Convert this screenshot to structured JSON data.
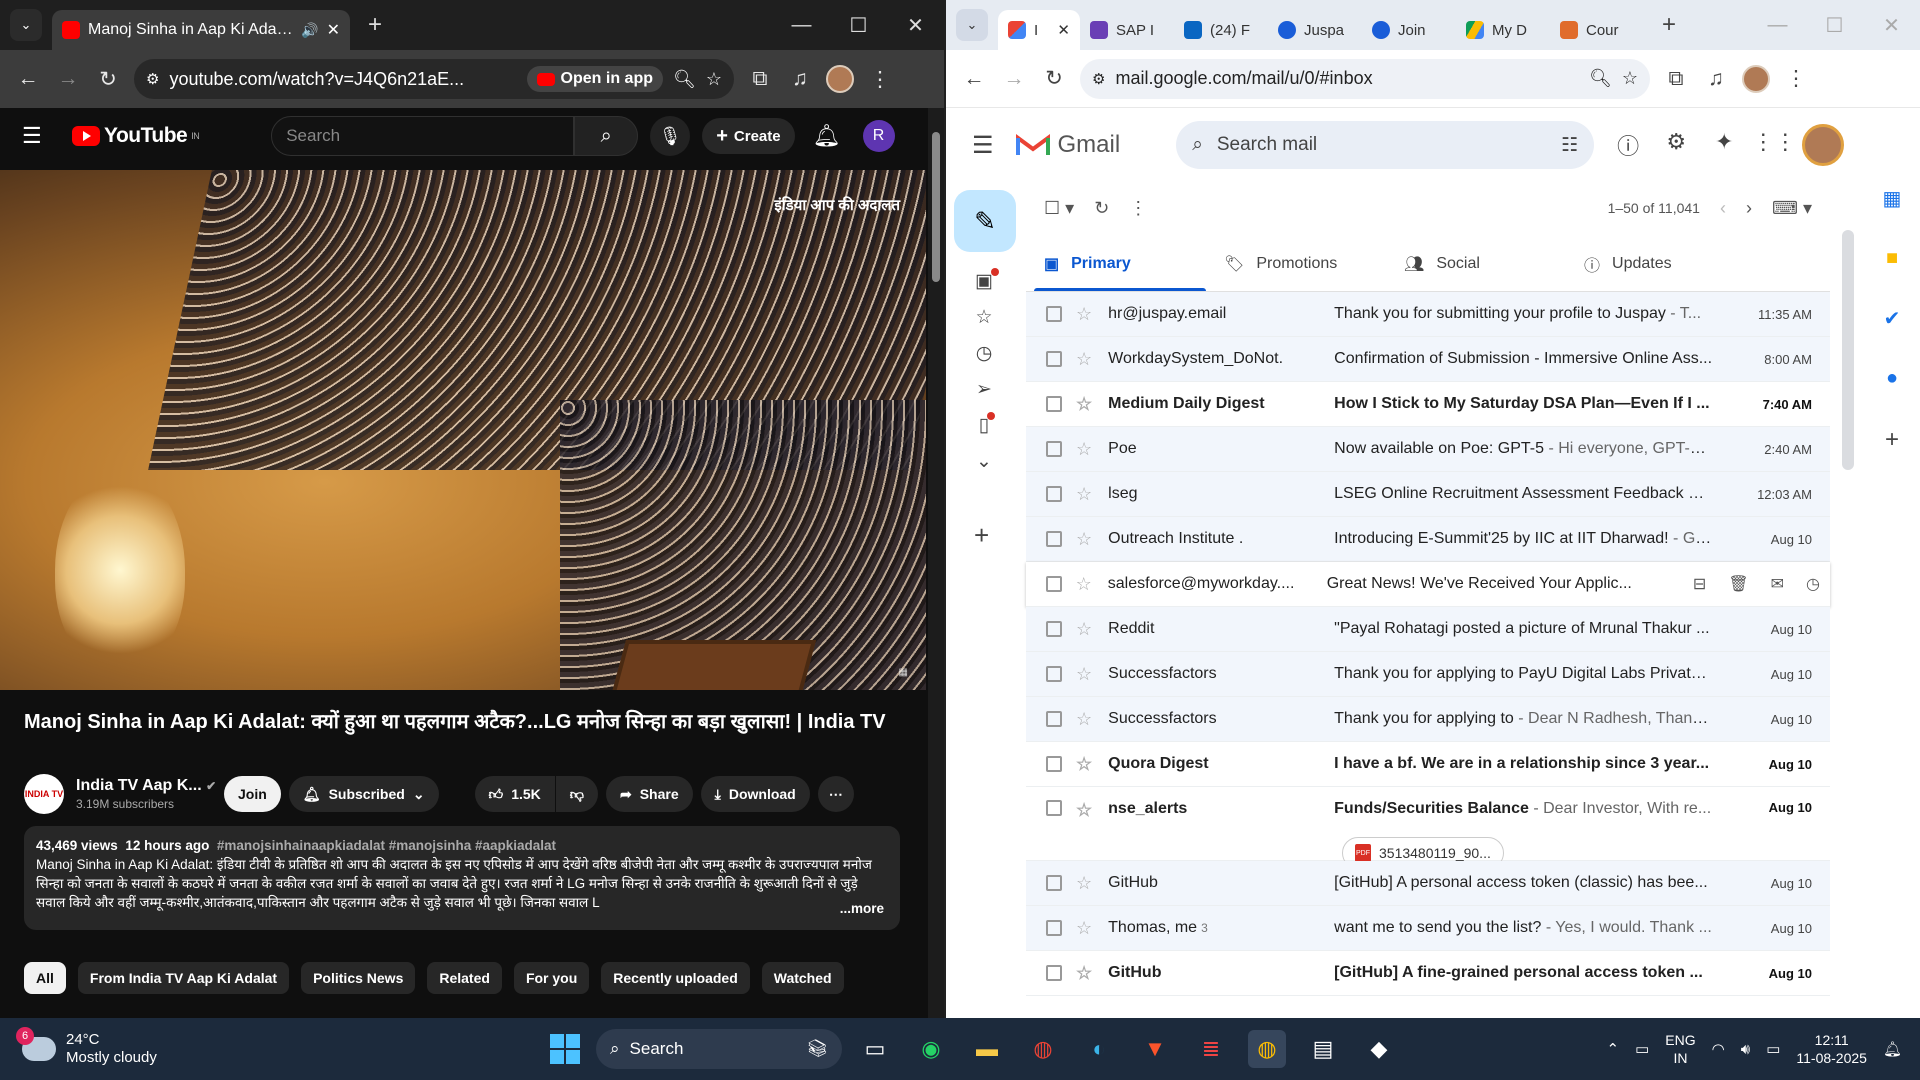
{
  "left_browser": {
    "tab_title": "Manoj Sinha in Aap Ki Adalat",
    "url": "youtube.com/watch?v=J4Q6n21aE...",
    "open_in_app": "Open in app"
  },
  "youtube": {
    "logo_text": "YouTube",
    "region": "IN",
    "search_placeholder": "Search",
    "create_label": "Create",
    "avatar_letter": "R",
    "video_watermark": "इंडिया आप की अदालत",
    "video_title": "Manoj Sinha in Aap Ki Adalat: क्यों हुआ था पहलगाम अटैक?...LG मनोज सिन्हा का बड़ा खुलासा! | India TV",
    "channel_name": "India TV Aap K...",
    "channel_subs": "3.19M subscribers",
    "join_label": "Join",
    "subscribed_label": "Subscribed",
    "likes": "1.5K",
    "share_label": "Share",
    "download_label": "Download",
    "views": "43,469 views",
    "age": "12 hours ago",
    "hashtags": "#manojsinhainaapkiadalat #manojsinha #aapkiadalat",
    "description": "Manoj Sinha in Aap Ki Adalat: इंडिया टीवी के प्रतिष्ठित शो आप की अदालत के इस नए एपिसोड में आप देखेंगे वरिष्ठ बीजेपी नेता और जम्मू कश्मीर के उपराज्यपाल मनोज सिन्हा को जनता के सवालों के कठघरे में जनता के वकील रजत शर्मा के सवालों का जवाब देते हुए। रजत शर्मा ने LG मनोज सिन्हा से उनके राजनीति के शुरूआती दिनों से जुड़े सवाल किये और वहीं जम्मू-कश्मीर,आतंकवाद,पाकिस्तान और पहलगाम अटैक से जुड़े सवाल भी पूछे। जिनका सवाल L",
    "more_label": "...more",
    "chips": [
      "All",
      "From India TV Aap Ki Adalat",
      "Politics News",
      "Related",
      "For you",
      "Recently uploaded",
      "Watched"
    ]
  },
  "right_browser": {
    "tabs": [
      "I",
      "SAP I",
      "(24) F",
      "Juspa",
      "Join",
      "My D",
      "Cour"
    ],
    "url": "mail.google.com/mail/u/0/#inbox"
  },
  "gmail": {
    "logo_text": "Gmail",
    "search_placeholder": "Search mail",
    "pagination": "1–50 of 11,041",
    "tabs": [
      "Primary",
      "Promotions",
      "Social",
      "Updates"
    ],
    "emails": [
      {
        "from": "hr@juspay.email",
        "subject": "Thank you for submitting your profile to Juspay",
        "snippet": " - T...",
        "date": "11:35 AM",
        "unread": false
      },
      {
        "from": "WorkdaySystem_DoNot.",
        "subject": "Confirmation of Submission - Immersive Online Ass...",
        "snippet": "",
        "date": "8:00 AM",
        "unread": false
      },
      {
        "from": "Medium Daily Digest",
        "subject": "How I Stick to My Saturday DSA Plan—Even If I ...",
        "snippet": "",
        "date": "7:40 AM",
        "unread": true
      },
      {
        "from": "Poe",
        "subject": "Now available on Poe: GPT-5",
        "snippet": " - Hi everyone, GPT-5, ...",
        "date": "2:40 AM",
        "unread": false
      },
      {
        "from": "lseg",
        "subject": "LSEG Online Recruitment Assessment Feedback Re...",
        "snippet": "",
        "date": "12:03 AM",
        "unread": false
      },
      {
        "from": "Outreach Institute .",
        "subject": "Introducing E-Summit'25 by IIC at IIT Dharwad!",
        "snippet": " - Gr...",
        "date": "Aug 10",
        "unread": false
      },
      {
        "from": "salesforce@myworkday....",
        "subject": "Great News! We've Received Your Applic...",
        "snippet": "",
        "date": "",
        "unread": false,
        "hover": true
      },
      {
        "from": "Reddit",
        "subject": "\"Payal Rohatagi posted a picture of Mrunal Thakur ...",
        "snippet": "",
        "date": "Aug 10",
        "unread": false
      },
      {
        "from": "Successfactors",
        "subject": "Thank you for applying to PayU Digital Labs Private ...",
        "snippet": "",
        "date": "Aug 10",
        "unread": false
      },
      {
        "from": "Successfactors",
        "subject": "Thank you for applying to",
        "snippet": " - Dear N Radhesh, Thank ...",
        "date": "Aug 10",
        "unread": false
      },
      {
        "from": "Quora Digest",
        "subject": "I have a bf. We are in a relationship since 3 year...",
        "snippet": "",
        "date": "Aug 10",
        "unread": true
      },
      {
        "from": "nse_alerts",
        "subject": "Funds/Securities Balance",
        "snippet": " - Dear Investor, With re...",
        "date": "Aug 10",
        "unread": true,
        "attachment": "3513480119_90..."
      },
      {
        "from": "GitHub",
        "subject": "[GitHub] A personal access token (classic) has bee...",
        "snippet": "",
        "date": "Aug 10",
        "unread": false
      },
      {
        "from": "Thomas, me",
        "count": "3",
        "subject": "want me to send you the list?",
        "snippet": " - Yes, I would. Thank ...",
        "date": "Aug 10",
        "unread": false
      },
      {
        "from": "GitHub",
        "subject": "[GitHub] A fine-grained personal access token ...",
        "snippet": "",
        "date": "Aug 10",
        "unread": true
      }
    ]
  },
  "taskbar": {
    "weather_badge": "6",
    "temperature": "24°C",
    "weather": "Mostly cloudy",
    "search_placeholder": "Search",
    "lang_top": "ENG",
    "lang_bottom": "IN",
    "time": "12:11",
    "date": "11-08-2025"
  }
}
